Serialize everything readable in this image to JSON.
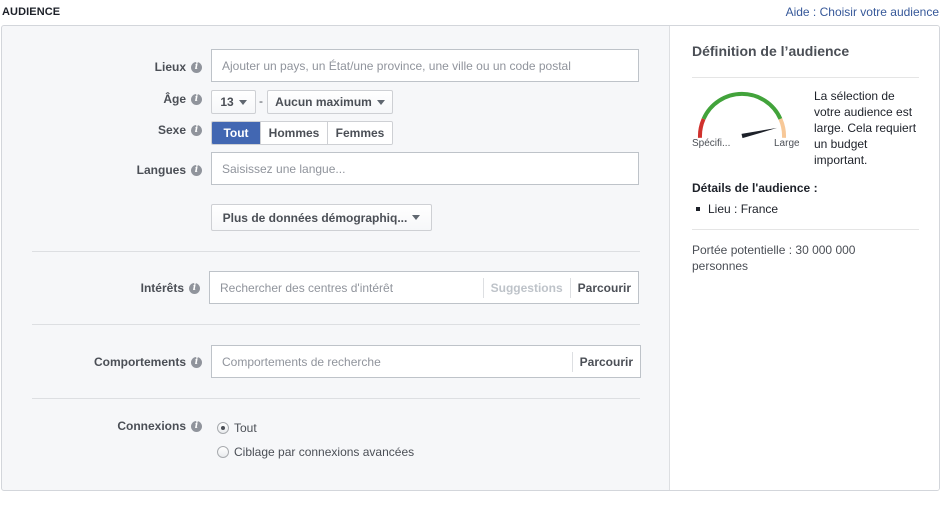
{
  "header": {
    "title": "AUDIENCE",
    "help_link": "Aide : Choisir votre audience"
  },
  "form": {
    "locations": {
      "label": "Lieux",
      "placeholder": "Ajouter un pays, un État/une province, une ville ou un code postal"
    },
    "age": {
      "label": "Âge",
      "min": "13",
      "separator": "-",
      "max": "Aucun maximum"
    },
    "gender": {
      "label": "Sexe",
      "options": [
        "Tout",
        "Hommes",
        "Femmes"
      ],
      "selected": "Tout"
    },
    "languages": {
      "label": "Langues",
      "placeholder": "Saisissez une langue..."
    },
    "more_demographics": "Plus de données démographiq...",
    "interests": {
      "label": "Intérêts",
      "placeholder": "Rechercher des centres d'intérêt",
      "suggestions": "Suggestions",
      "browse": "Parcourir"
    },
    "behaviors": {
      "label": "Comportements",
      "placeholder": "Comportements de recherche",
      "browse": "Parcourir"
    },
    "connections": {
      "label": "Connexions",
      "options": [
        "Tout",
        "Ciblage par connexions avancées"
      ],
      "selected": "Tout"
    }
  },
  "sidebar": {
    "title": "Définition de l’audience",
    "gauge": {
      "left_label": "Spécifi...",
      "right_label": "Large",
      "level": 0.85,
      "colors": {
        "narrow": "#d0312d",
        "good": "#42a33b",
        "broad": "#f7c898",
        "needle": "#1d2129"
      }
    },
    "gauge_text": "La sélection de votre audience est large. Cela requiert un budget important.",
    "details_title": "Détails de l'audience :",
    "details": [
      "Lieu : France"
    ],
    "reach": "Portée potentielle : 30 000 000 personnes"
  },
  "colors": {
    "accent": "#4267b2",
    "link": "#365899",
    "panel_bg": "#f6f7f9"
  }
}
